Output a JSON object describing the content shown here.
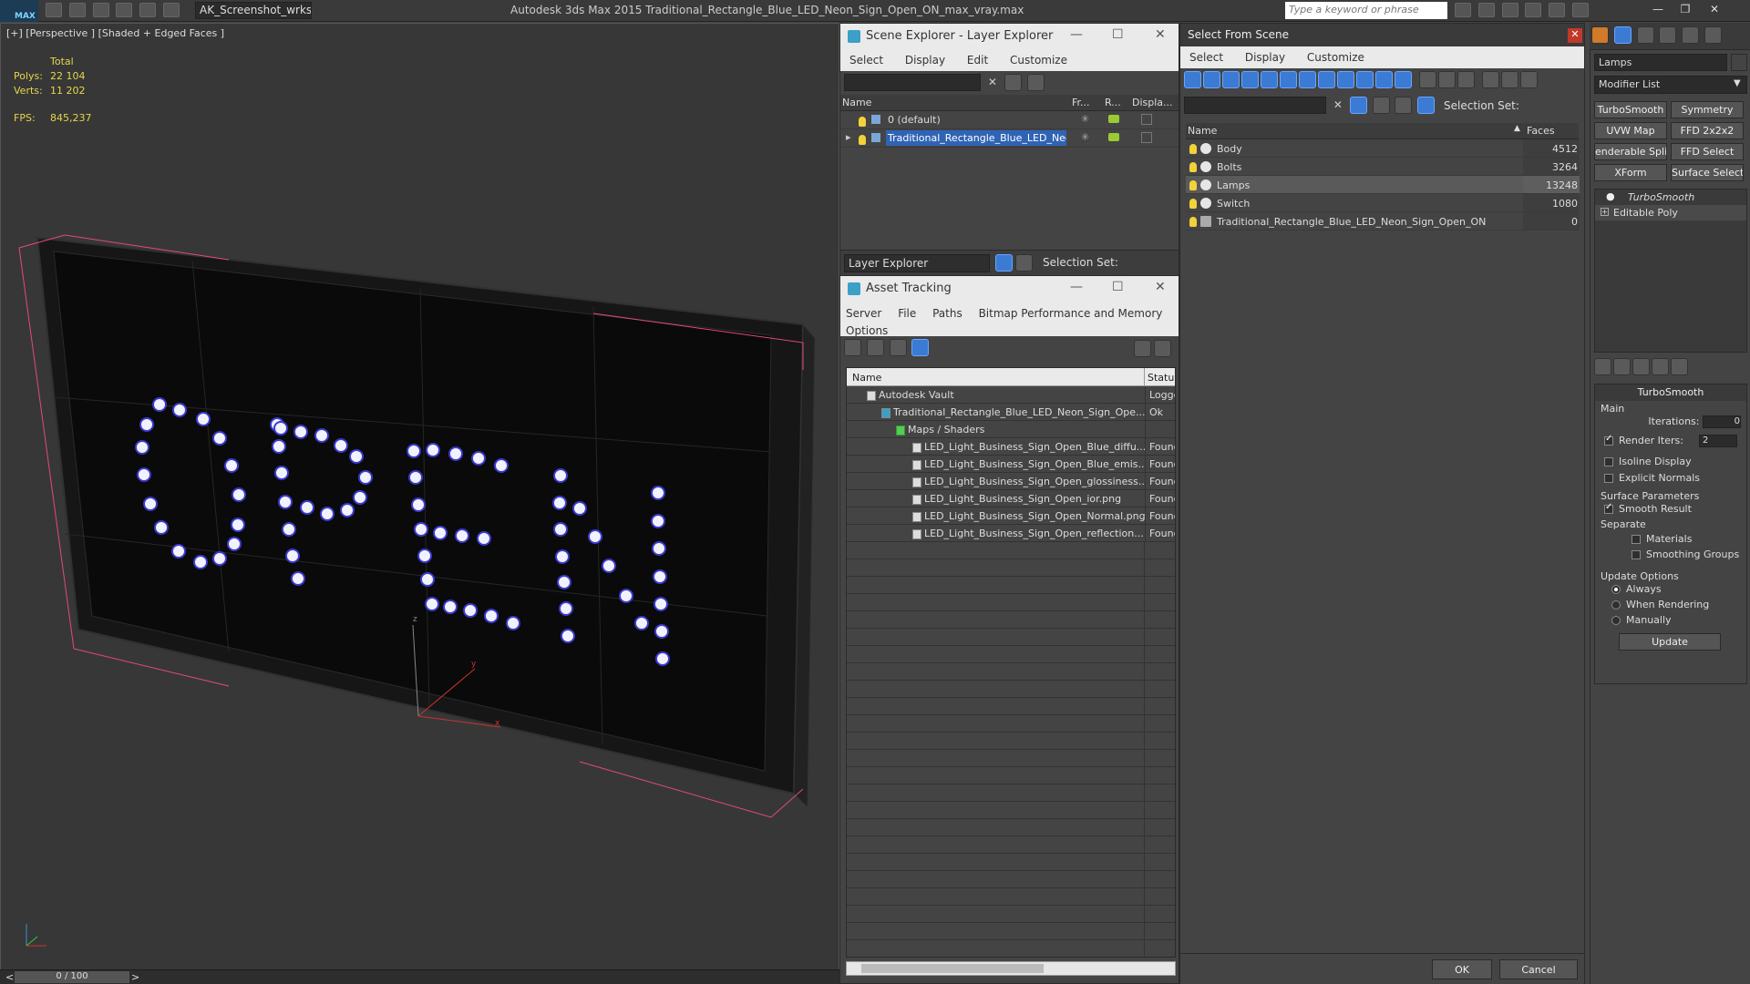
{
  "app": {
    "logo": "MAX",
    "workspace": "AK_Screenshot_wrksp",
    "window_title": "Autodesk 3ds Max  2015     Traditional_Rectangle_Blue_LED_Neon_Sign_Open_ON_max_vray.max",
    "search_placeholder": "Type a keyword or phrase"
  },
  "viewport": {
    "label": "[+] [Perspective ] [Shaded + Edged Faces ]",
    "stats": {
      "total_label": "Total",
      "polys_label": "Polys:",
      "polys_value": "22 104",
      "verts_label": "Verts:",
      "verts_value": "11 202",
      "fps_label": "FPS:",
      "fps_value": "845,237"
    },
    "axis_x": "x",
    "axis_y": "y",
    "axis_z": "z",
    "sign_text": "OPEN"
  },
  "timeline": {
    "frame": "0 / 100",
    "prev": "<",
    "next": ">"
  },
  "scene_explorer": {
    "title": "Scene Explorer - Layer Explorer",
    "menu": [
      "Select",
      "Display",
      "Edit",
      "Customize"
    ],
    "columns": [
      "Name",
      "Fr...",
      "R...",
      "Displa..."
    ],
    "rows": [
      {
        "name": "0 (default)"
      },
      {
        "name": "Traditional_Rectangle_Blue_LED_Neo..."
      }
    ],
    "footer_dropdown": "Layer Explorer",
    "selection_set_label": "Selection Set:"
  },
  "asset_tracking": {
    "title": "Asset Tracking",
    "menu": [
      "Server",
      "File",
      "Paths",
      "Bitmap Performance and Memory"
    ],
    "menu2": "Options",
    "columns": [
      "Name",
      "Status"
    ],
    "rows": [
      {
        "name": "Autodesk Vault",
        "status": "Logge"
      },
      {
        "name": "Traditional_Rectangle_Blue_LED_Neon_Sign_Ope...",
        "status": "Ok"
      },
      {
        "name": "Maps / Shaders",
        "status": ""
      },
      {
        "name": "LED_Light_Business_Sign_Open_Blue_diffu...",
        "status": "Found"
      },
      {
        "name": "LED_Light_Business_Sign_Open_Blue_emis...",
        "status": "Found"
      },
      {
        "name": "LED_Light_Business_Sign_Open_glossiness...",
        "status": "Found"
      },
      {
        "name": "LED_Light_Business_Sign_Open_ior.png",
        "status": "Found"
      },
      {
        "name": "LED_Light_Business_Sign_Open_Normal.png",
        "status": "Found"
      },
      {
        "name": "LED_Light_Business_Sign_Open_reflection...",
        "status": "Found"
      }
    ]
  },
  "select_from_scene": {
    "title": "Select From Scene",
    "menu": [
      "Select",
      "Display",
      "Customize"
    ],
    "selection_set_label": "Selection Set:",
    "columns": [
      "Name",
      "Faces"
    ],
    "rows": [
      {
        "name": "Body",
        "faces": "4512"
      },
      {
        "name": "Bolts",
        "faces": "3264"
      },
      {
        "name": "Lamps",
        "faces": "13248"
      },
      {
        "name": "Switch",
        "faces": "1080"
      },
      {
        "name": "Traditional_Rectangle_Blue_LED_Neon_Sign_Open_ON",
        "faces": "0"
      }
    ],
    "ok": "OK",
    "cancel": "Cancel"
  },
  "command_panel": {
    "object_name": "Lamps",
    "modifier_list": "Modifier List",
    "buttons": [
      "TurboSmooth",
      "Symmetry",
      "UVW Map",
      "FFD 2x2x2",
      "enderable Splir",
      "FFD Select",
      "XForm",
      "Surface Select"
    ],
    "stack": [
      "TurboSmooth",
      "Editable Poly"
    ],
    "turbosmooth": {
      "title": "TurboSmooth",
      "main": "Main",
      "iterations_label": "Iterations:",
      "iterations": "0",
      "render_iters_label": "Render Iters:",
      "render_iters": "2",
      "isoline": "Isoline Display",
      "explicit": "Explicit Normals",
      "surface_params": "Surface Parameters",
      "smooth_result": "Smooth Result",
      "separate": "Separate",
      "materials": "Materials",
      "smoothing_groups": "Smoothing Groups",
      "update_options": "Update Options",
      "always": "Always",
      "when_rendering": "When Rendering",
      "manually": "Manually",
      "update": "Update"
    }
  }
}
